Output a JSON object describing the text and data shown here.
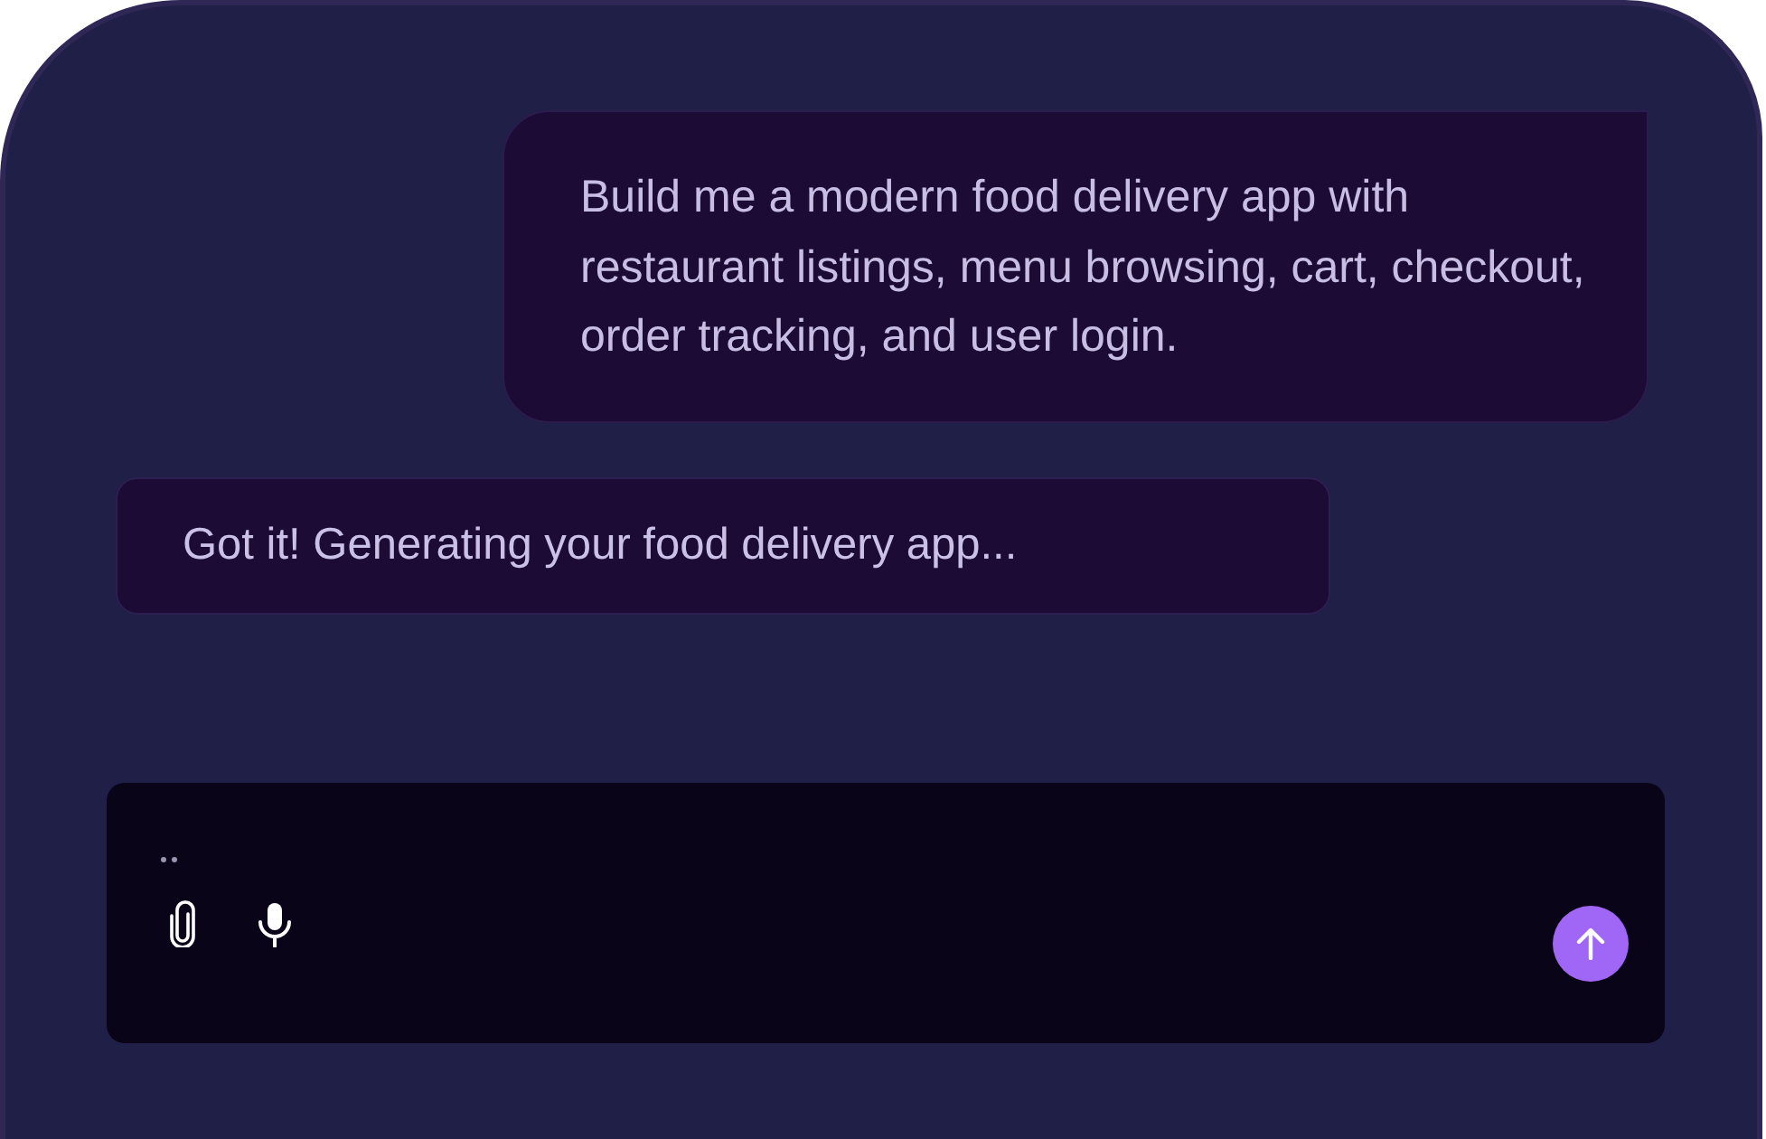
{
  "messages": [
    {
      "kind": "sent",
      "text": "Build me a modern food delivery app with restaurant listings, menu browsing, cart, checkout, order tracking, and user login."
    },
    {
      "kind": "received",
      "text": "Got it! Generating your food delivery app..."
    }
  ],
  "composer": {
    "send_disabled": false
  }
}
